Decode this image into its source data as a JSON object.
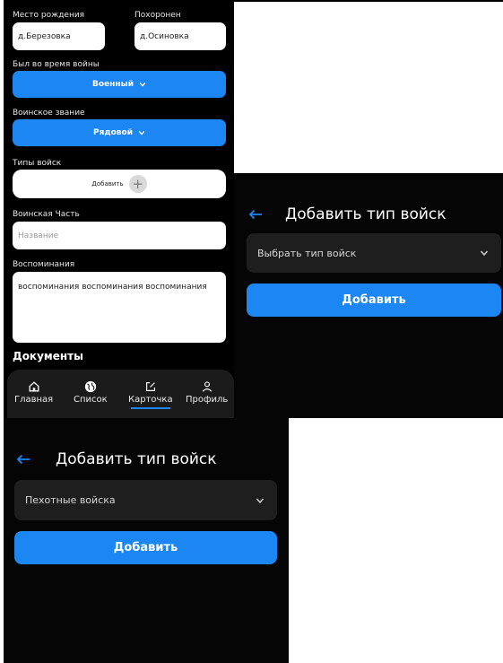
{
  "form": {
    "birthplace": {
      "label": "Место рождения",
      "value": "д.Березовка"
    },
    "buried": {
      "label": "Похоронен",
      "value": "д.Осиновка"
    },
    "war_role": {
      "label": "Был во время войны",
      "value": "Военный"
    },
    "rank": {
      "label": "Воинское звание",
      "value": "Рядовой"
    },
    "troop_types": {
      "label": "Типы войск",
      "add_label": "Добавить"
    },
    "unit": {
      "label": "Воинская Часть",
      "placeholder": "Название"
    },
    "memories": {
      "label": "Воспоминания",
      "value": "воспоминания воспоминания воспоминания"
    },
    "documents_heading": "Документы"
  },
  "nav": {
    "items": [
      {
        "label": "Главная",
        "icon": "home-icon"
      },
      {
        "label": "Список",
        "icon": "globe-icon"
      },
      {
        "label": "Карточка",
        "icon": "edit-icon",
        "active": true
      },
      {
        "label": "Профиль",
        "icon": "user-icon"
      }
    ]
  },
  "add_troop_dialog_empty": {
    "title": "Добавить тип войск",
    "select_placeholder": "Выбрать тип войск",
    "button": "Добавить"
  },
  "add_troop_dialog_selected": {
    "title": "Добавить тип войск",
    "selected": "Пехотные войска",
    "button": "Добавить"
  },
  "colors": {
    "accent": "#1c86f2",
    "background": "#000000",
    "surface": "#1e1e1e"
  }
}
